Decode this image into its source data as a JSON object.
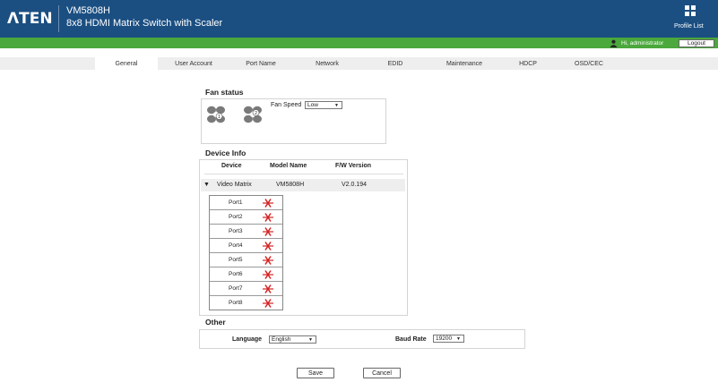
{
  "header": {
    "logo": "ΛTEN",
    "model": "VM5808H",
    "subtitle": "8x8 HDMI Matrix Switch with Scaler",
    "profile_label": "Profile List"
  },
  "userbar": {
    "greeting": "Hi, administrator",
    "logout_label": "Logout"
  },
  "tabs": [
    {
      "label": "General",
      "active": true
    },
    {
      "label": "User Account",
      "active": false
    },
    {
      "label": "Port Name",
      "active": false
    },
    {
      "label": "Network",
      "active": false
    },
    {
      "label": "EDID",
      "active": false
    },
    {
      "label": "Maintenance",
      "active": false
    },
    {
      "label": "HDCP",
      "active": false
    },
    {
      "label": "OSD/CEC",
      "active": false
    }
  ],
  "fan_status": {
    "title": "Fan status",
    "fans": [
      "1",
      "2"
    ],
    "speed_label": "Fan Speed",
    "speed_value": "Low"
  },
  "device_info": {
    "title": "Device Info",
    "columns": [
      "Device",
      "Model Name",
      "F/W Version"
    ],
    "device": {
      "name": "Video Matrix",
      "model": "VM5808H",
      "fw": "V2.0.194"
    },
    "ports": [
      "Port1",
      "Port2",
      "Port3",
      "Port4",
      "Port5",
      "Port6",
      "Port7",
      "Port8"
    ]
  },
  "other": {
    "title": "Other",
    "language_label": "Language",
    "language_value": "English",
    "baud_label": "Baud Rate",
    "baud_value": "19200"
  },
  "actions": {
    "save_label": "Save",
    "cancel_label": "Cancel"
  },
  "colors": {
    "header_bg": "#1b4f82",
    "status_bar": "#4aa83c",
    "disconnected": "#d42020"
  }
}
